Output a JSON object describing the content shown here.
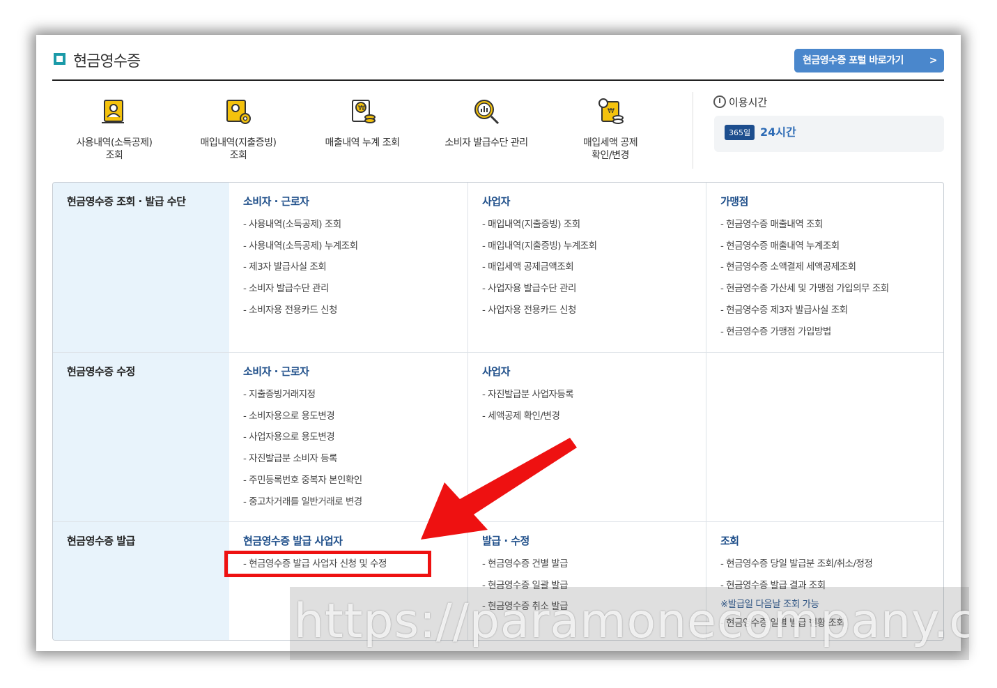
{
  "header": {
    "title": "현금영수증",
    "portal_button": "현금영수증 포털 바로가기"
  },
  "quick_links": [
    {
      "label": "사용내역(소득공제)\n조회",
      "icon": "receipt-user-icon"
    },
    {
      "label": "매입내역(지출증빙)\n조회",
      "icon": "receipt-settings-icon"
    },
    {
      "label": "매출내역 누계 조회",
      "icon": "receipt-coins-icon"
    },
    {
      "label": "소비자 발급수단 관리",
      "icon": "magnifier-chart-icon"
    },
    {
      "label": "매입세액 공제\n확인/변경",
      "icon": "receipt-gear-coins-icon"
    }
  ],
  "hours": {
    "label": "이용시간",
    "days": "365일",
    "time": "24시간"
  },
  "sections": [
    {
      "title": "현금영수증 조회 · 발급 수단",
      "columns": [
        {
          "heading": "소비자 · 근로자",
          "items": [
            "- 사용내역(소득공제) 조회",
            "- 사용내역(소득공제) 누계조회",
            "- 제3자 발급사실 조회",
            "- 소비자 발급수단 관리",
            "- 소비자용 전용카드 신청"
          ]
        },
        {
          "heading": "사업자",
          "items": [
            "- 매입내역(지출증빙) 조회",
            "- 매입내역(지출증빙) 누계조회",
            "- 매입세액 공제금액조회",
            "- 사업자용 발급수단 관리",
            "- 사업자용 전용카드 신청"
          ]
        },
        {
          "heading": "가맹점",
          "items": [
            "- 현금영수증 매출내역 조회",
            "- 현금영수증 매출내역 누계조회",
            "- 현금영수증 소액결제 세액공제조회",
            "- 현금영수증 가산세 및 가맹점 가입의무 조회",
            "- 현금영수증 제3자 발급사실 조회",
            "- 현금영수증 가맹점 가입방법"
          ]
        }
      ]
    },
    {
      "title": "현금영수증 수정",
      "columns": [
        {
          "heading": "소비자 · 근로자",
          "items": [
            "- 지출증빙거래지정",
            "- 소비자용으로 용도변경",
            "- 사업자용으로 용도변경",
            "- 자진발급분 소비자 등록",
            "- 주민등록번호 중복자 본인확인",
            "- 중고차거래를 일반거래로 변경"
          ]
        },
        {
          "heading": "사업자",
          "items": [
            "- 자진발급분 사업자등록",
            "- 세액공제 확인/변경"
          ]
        }
      ]
    },
    {
      "title": "현금영수증 발급",
      "columns": [
        {
          "heading": "현금영수증 발급 사업자",
          "items": [
            "- 현금영수증 발급 사업자 신청 및 수정"
          ]
        },
        {
          "heading": "발급 · 수정",
          "items": [
            "- 현금영수증 건별 발급",
            "- 현금영수증 일괄 발급",
            "- 현금영수증 취소 발급"
          ]
        },
        {
          "heading": "조회",
          "items": [
            "- 현금영수증 당일 발급분 조회/취소/정정",
            "- 현금영수증 발급 결과 조회"
          ],
          "note": "※발급일 다음날 조회 가능",
          "items_after": [
            "- 현금영수증 일별 발급 현황 조회"
          ]
        }
      ]
    }
  ],
  "watermark": "https://paramonecompany.com",
  "colors": {
    "accent": "#4a87cc",
    "heading": "#1f4f8a",
    "row_head_bg": "#e8f3fb",
    "highlight": "#ee1111"
  }
}
